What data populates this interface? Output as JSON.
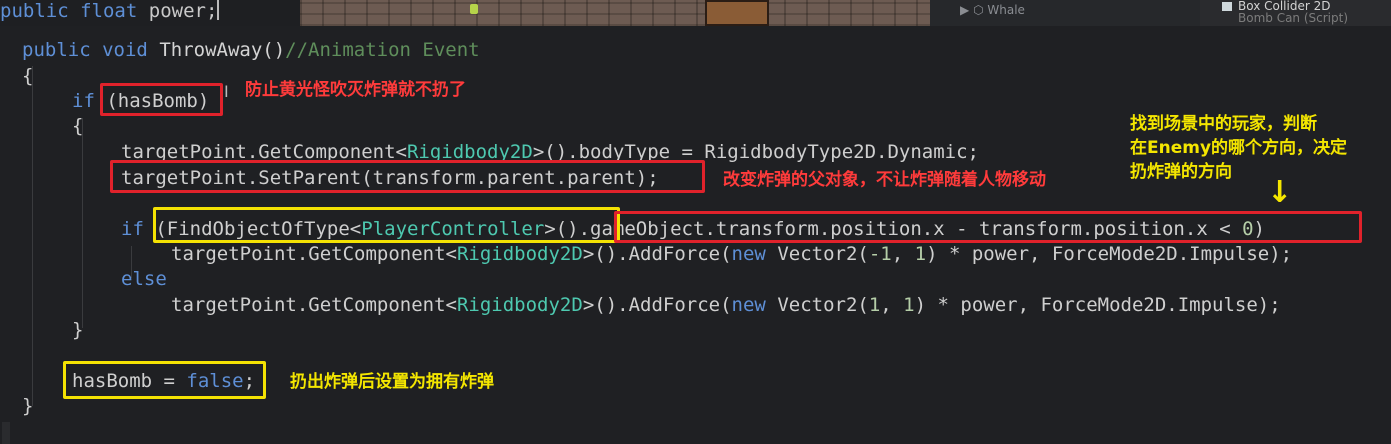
{
  "top": {
    "code_line": {
      "kw1": "public",
      "kw2": "float",
      "rest": "power;"
    },
    "hierarchy_item": "Whale",
    "inspector": {
      "row1": "Box Collider 2D",
      "row2": "Bomb Can (Script)"
    }
  },
  "code": {
    "l1": {
      "kw1": "public",
      "kw2": "void",
      "name": "ThrowAway()",
      "comment": "//Animation Event"
    },
    "l2": "{",
    "l3": {
      "kw": "if",
      "cond": "(hasBomb)"
    },
    "l4": "{",
    "l5": {
      "a": "targetPoint.GetComponent<",
      "t1": "Rigidbody2D",
      "b": ">().bodyType = ",
      "c": "RigidbodyType2D.Dynamic",
      "d": ";"
    },
    "l6": "targetPoint.SetParent(transform.parent.parent);",
    "l7": {
      "kw": "if",
      "open": "(FindObjectOfType<",
      "t1": "PlayerController",
      "mid": ">()",
      "rest": ".gameObject.transform.position.x - transform.position.x < ",
      "num": "0",
      "close": ")"
    },
    "l8": {
      "a": "targetPoint.GetComponent<",
      "t1": "Rigidbody2D",
      "b": ">().AddForce(",
      "kw": "new",
      "c": " Vector2(",
      "n1": "-1",
      "d": ", ",
      "n2": "1",
      "e": ") * power, ForceMode2D.Impulse);"
    },
    "l9": {
      "kw": "else"
    },
    "l10": {
      "a": "targetPoint.GetComponent<",
      "t1": "Rigidbody2D",
      "b": ">().AddForce(",
      "kw": "new",
      "c": " Vector2(",
      "n1": "1",
      "d": ", ",
      "n2": "1",
      "e": ") * power, ForceMode2D.Impulse);"
    },
    "l11": "}",
    "l12": {
      "a": "hasBomb = ",
      "kw": "false",
      "b": ";"
    },
    "l13": "}"
  },
  "annotations": {
    "hasbomb_note": "防止黄光怪吹灭炸弹就不扔了",
    "setparent_note": "改变炸弹的父对象，不让炸弹随着人物移动",
    "direction_note_1": "找到场景中的玩家，判断",
    "direction_note_2": "在Enemy的哪个方向，决定",
    "direction_note_3": "扔炸弹的方向",
    "arrow_icon": "↓",
    "hasbomb_false_note": "扔出炸弹后设置为拥有炸弹"
  },
  "colors": {
    "red": "#e0222b",
    "yellow": "#f4e203",
    "keyword": "#5e8fd6",
    "type": "#4ec9b0",
    "comment": "#5f8e5b"
  }
}
